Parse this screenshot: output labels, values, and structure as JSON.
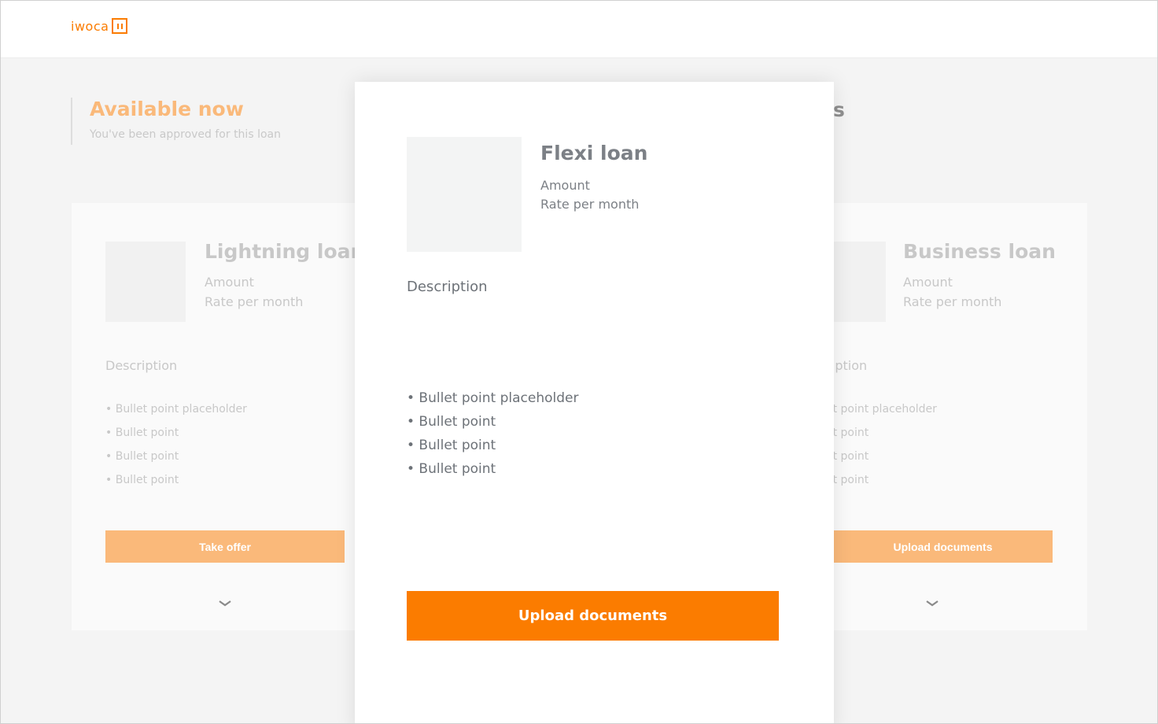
{
  "brand": {
    "logo_text": "iwoca",
    "accent": "#fb7c00"
  },
  "section": {
    "title": "Available now",
    "subtitle": "You've been approved for this loan",
    "right_title_fragment": "s"
  },
  "cards": {
    "left": {
      "name": "Lightning loan",
      "amount_label": "Amount",
      "rate_label": "Rate per month",
      "description_label": "Description",
      "bullets": [
        "• Bullet point placeholder",
        "• Bullet point",
        "• Bullet point",
        "• Bullet point"
      ],
      "cta": "Take offer"
    },
    "right": {
      "name": "Business loan",
      "amount_label": "Amount",
      "rate_label": "Rate per month",
      "description_label": "Description",
      "bullets": [
        "• Bullet point placeholder",
        "• Bullet point",
        "• Bullet point",
        "• Bullet point"
      ],
      "cta": "Upload documents"
    }
  },
  "modal": {
    "name": "Flexi loan",
    "amount_label": "Amount",
    "rate_label": "Rate per month",
    "description_label": "Description",
    "bullets": [
      "• Bullet point placeholder",
      "• Bullet point",
      "• Bullet point",
      "• Bullet point"
    ],
    "cta": "Upload documents"
  },
  "icons": {
    "card_expand": "chevron-down-icon",
    "logo_mark": "iwoca-logo-icon"
  }
}
